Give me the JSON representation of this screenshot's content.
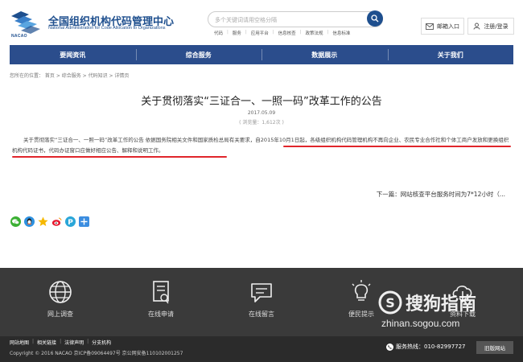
{
  "header": {
    "logo_text": "NACAO",
    "title": "全国组织机构代码管理中心",
    "subtitle": "National Administration for Code Allocation to Organizations",
    "search": {
      "placeholder": "多个关键词请用空格分隔"
    },
    "quick_links": [
      "代码",
      "服务",
      "应用平台",
      "信息核查",
      "政策法规",
      "信息标准"
    ],
    "mailbox_label": "邮箱入口",
    "login_label": "注册/登录"
  },
  "nav": {
    "items": [
      "要闻资讯",
      "综合服务",
      "数据展示",
      "关于我们"
    ]
  },
  "breadcrumb": "您所在的位置： 首页 > 综合服务 > 代码知识 > 详情页",
  "article": {
    "title": "关于贯彻落实“三证合一、一照一码”改革工作的公告",
    "date": "2017.05.09",
    "views": "( 浏览量：1,612次 )",
    "body": "关于贯彻落实“三证合一、一照一码”改革工作的公告 依据国务院相关文件和国家质检总局有关要求，自2015年10月1日起，各级组织机构代码管理机构不再向企业、农民专业合作社和个体工商户发放和更换组织机构代码证书，代码办证窗口应做好相应公告、解释和说明工作。",
    "next_label": "下一篇：网站核查平台服务时间为7*12小时（..."
  },
  "share_icons": [
    "wechat-icon",
    "qq-icon",
    "qzone-icon",
    "weibo-icon",
    "pinterest-icon",
    "plus-icon"
  ],
  "footer": {
    "items": [
      {
        "label": "网上调查",
        "icon": "globe-icon"
      },
      {
        "label": "在线申请",
        "icon": "document-icon"
      },
      {
        "label": "在线留言",
        "icon": "chat-icon"
      },
      {
        "label": "便民提示",
        "icon": "lightbulb-icon"
      },
      {
        "label": "资料下载",
        "icon": "cloud-download-icon"
      }
    ],
    "links": [
      "网站地图",
      "相关链接",
      "法律声明",
      "分支机构"
    ],
    "copyright": "Copyright © 2016 NACAO 京ICP备09064497号 京公网安备110102001257",
    "hotline": "服务热线：010-82997727",
    "old_site": "旧版网站"
  },
  "watermark": {
    "brand": "搜狗指南",
    "url": "zhinan.sogou.com"
  },
  "colors": {
    "brand_blue": "#1e4f8e",
    "nav_blue": "#2b4d8c",
    "highlight_red": "#e0252b",
    "footer_bg": "#3a3a3a"
  }
}
